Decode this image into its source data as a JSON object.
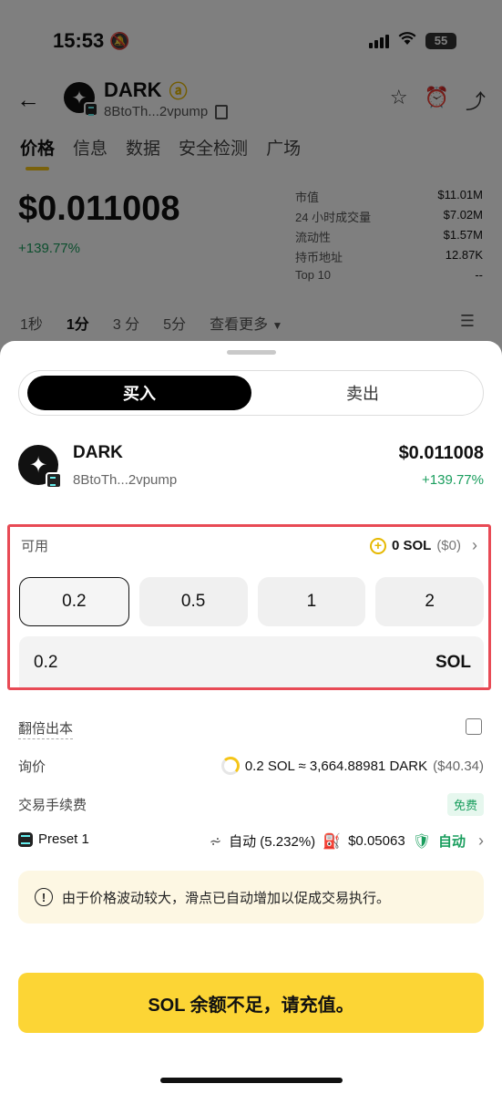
{
  "status": {
    "time": "15:53",
    "battery": "55"
  },
  "header": {
    "token_name": "DARK",
    "token_address": "8BtoTh...2vpump",
    "tabs": [
      "价格",
      "信息",
      "数据",
      "安全检测",
      "广场"
    ]
  },
  "price_panel": {
    "price": "$0.011008",
    "change": "+139.77%",
    "stats": [
      {
        "label": "市值",
        "value": "$11.01M"
      },
      {
        "label": "24 小时成交量",
        "value": "$7.02M"
      },
      {
        "label": "流动性",
        "value": "$1.57M"
      },
      {
        "label": "持币地址",
        "value": "12.87K"
      },
      {
        "label": "Top 10",
        "value": "--"
      }
    ],
    "intervals": [
      "1秒",
      "1分",
      "3 分",
      "5分",
      "查看更多"
    ]
  },
  "sheet": {
    "buy_label": "买入",
    "sell_label": "卖出",
    "token": {
      "name": "DARK",
      "address": "8BtoTh...2vpump",
      "price": "$0.011008",
      "change": "+139.77%"
    },
    "available_label": "可用",
    "available_value": "0 SOL",
    "available_usd": "($0)",
    "quick_amounts": [
      "0.2",
      "0.5",
      "1",
      "2"
    ],
    "amount_value": "0.2",
    "amount_unit": "SOL",
    "double_label": "翻倍出本",
    "quote_label": "询价",
    "quote_value": "0.2 SOL ≈ 3,664.88981 DARK",
    "quote_usd": "($40.34)",
    "fee_label": "交易手续费",
    "fee_badge": "免费",
    "preset_label": "Preset 1",
    "slippage": "自动 (5.232%)",
    "gas": "$0.05063",
    "mev_label": "自动",
    "notice": "由于价格波动较大，滑点已自动增加以促成交易执行。",
    "cta": "SOL 余额不足，请充值。"
  }
}
